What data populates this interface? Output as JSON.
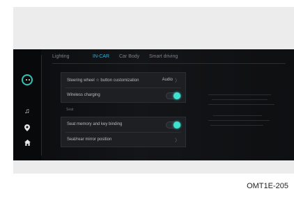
{
  "tabs": [
    {
      "label": "Lighting"
    },
    {
      "label": "IN-CAR"
    },
    {
      "label": "Car Body"
    },
    {
      "label": "Smart driving"
    }
  ],
  "active_tab_index": 1,
  "settings": {
    "steering_wheel": {
      "label": "Steering wheel ☆ button customization",
      "value": "Audio"
    },
    "wireless_charging": {
      "label": "Wireless charging",
      "toggle_on": true
    },
    "seat_section_label": "Seat",
    "seat_memory": {
      "label": "Seat memory and key binding",
      "toggle_on": true
    },
    "seat_mirror": {
      "label": "Seat/rear mirror position"
    }
  },
  "sidebar": {
    "icons": [
      "music-icon",
      "location-icon",
      "home-icon"
    ]
  },
  "caption": "OMT1E-205",
  "colors": {
    "accent": "#2fb0e0",
    "toggle_on": "#3ee3d0"
  }
}
